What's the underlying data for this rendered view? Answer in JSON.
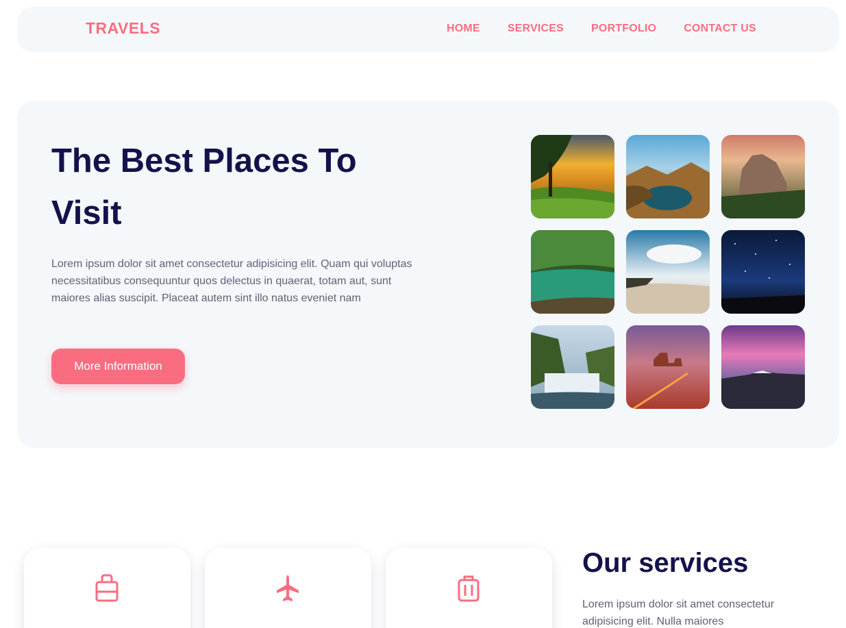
{
  "brand": {
    "logo": "TRAVELS",
    "accent_color": "#fa6d80",
    "heading_color": "#14124b"
  },
  "nav": {
    "links": [
      "HOME",
      "SERVICES",
      "PORTFOLIO",
      "CONTACT US"
    ]
  },
  "hero": {
    "title": "The Best Places To Visit",
    "description": "Lorem ipsum dolor sit amet consectetur adipisicing elit. Quam qui voluptas necessitatibus consequuntur quos delectus in quaerat, totam aut, sunt maiores alias suscipit. Placeat autem sint illo natus eveniet nam",
    "button_label": "More Information",
    "gallery": [
      "forest-sunset-photo",
      "island-lagoon-photo",
      "rock-canyon-sunset-photo",
      "green-river-forest-photo",
      "tropical-beach-photo",
      "starry-night-sky-photo",
      "waterfall-photo",
      "red-desert-road-photo",
      "purple-mountain-sky-photo"
    ]
  },
  "services": {
    "title": "Our services",
    "description": "Lorem ipsum dolor sit amet consectetur adipisicing elit. Nulla maiores",
    "cards": [
      {
        "icon": "shopping-bag-icon",
        "label": ""
      },
      {
        "icon": "airplane-icon",
        "label": ""
      },
      {
        "icon": "luggage-icon",
        "label": ""
      }
    ]
  }
}
